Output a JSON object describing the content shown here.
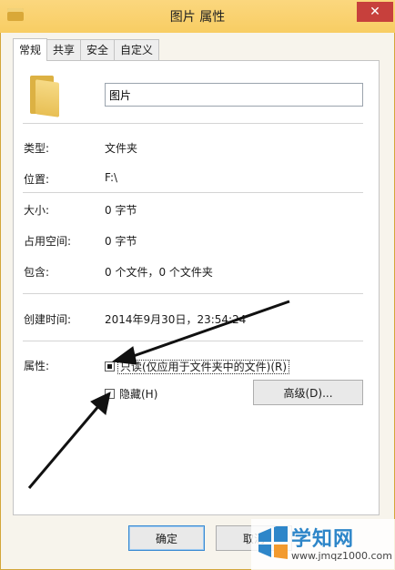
{
  "window": {
    "title": "图片 属性",
    "close_glyph": "✕"
  },
  "tabs": [
    {
      "label": "常规",
      "active": true
    },
    {
      "label": "共享",
      "active": false
    },
    {
      "label": "安全",
      "active": false
    },
    {
      "label": "自定义",
      "active": false
    }
  ],
  "general": {
    "folder_name": "图片",
    "type_label": "类型:",
    "type_value": "文件夹",
    "location_label": "位置:",
    "location_value": "F:\\",
    "size_label": "大小:",
    "size_value": "0 字节",
    "size_on_disk_label": "占用空间:",
    "size_on_disk_value": "0 字节",
    "contains_label": "包含:",
    "contains_value": "0 个文件，0 个文件夹",
    "created_label": "创建时间:",
    "created_value": "2014年9月30日，23:54:24",
    "attributes_label": "属性:",
    "readonly": {
      "label": "只读(仅应用于文件夹中的文件)(R)",
      "state": "indeterminate"
    },
    "hidden": {
      "label": "隐藏(H)",
      "checked": false
    },
    "advanced_label": "高级(D)..."
  },
  "footer": {
    "ok_label": "确定",
    "cancel_label": "取消"
  },
  "watermark": {
    "name": "学知网",
    "url": "www.jmqz1000.com"
  }
}
